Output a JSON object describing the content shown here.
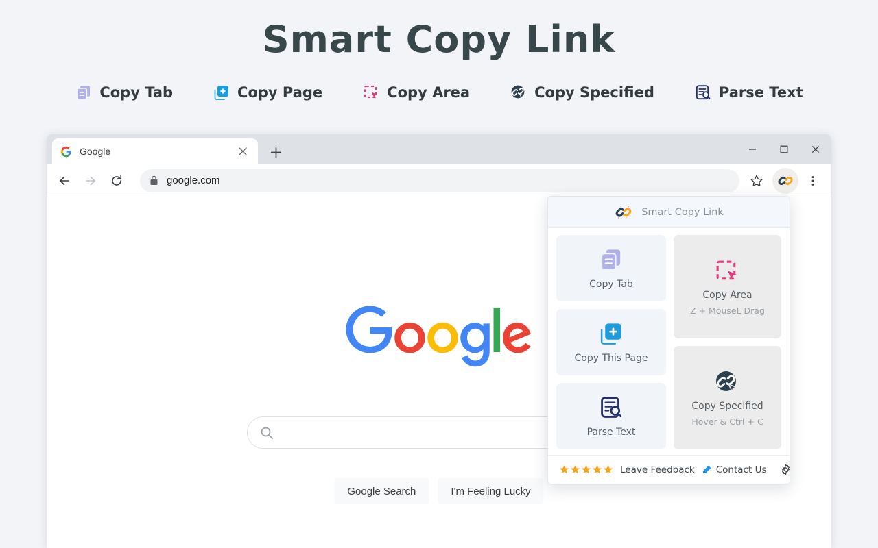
{
  "hero": {
    "title": "Smart Copy Link"
  },
  "features": [
    {
      "label": "Copy Tab",
      "icon": "copy-tab-icon"
    },
    {
      "label": "Copy Page",
      "icon": "copy-page-icon"
    },
    {
      "label": "Copy Area",
      "icon": "copy-area-icon"
    },
    {
      "label": "Copy Specified",
      "icon": "copy-specified-icon"
    },
    {
      "label": "Parse Text",
      "icon": "parse-text-icon"
    }
  ],
  "browser": {
    "tab": {
      "title": "Google",
      "favicon": "google-favicon",
      "close_icon": "close-icon"
    },
    "new_tab_icon": "plus-icon",
    "window_controls": {
      "minimize": "minimize-icon",
      "maximize": "maximize-icon",
      "close": "close-icon"
    },
    "toolbar": {
      "back_icon": "arrow-left-icon",
      "forward_icon": "arrow-right-icon",
      "reload_icon": "reload-icon",
      "lock_icon": "lock-icon",
      "url": "google.com",
      "bookmark_icon": "star-icon",
      "extension_icon": "smart-copy-link-icon",
      "menu_icon": "three-dots-icon"
    }
  },
  "google_page": {
    "logo": "google-logo",
    "search_icon": "search-icon",
    "search_placeholder": "",
    "buttons": [
      "Google Search",
      "I'm Feeling Lucky"
    ]
  },
  "popup": {
    "header": {
      "logo": "smart-copy-link-icon",
      "title": "Smart Copy Link"
    },
    "left_cards": [
      {
        "label": "Copy Tab",
        "icon": "copy-tab-icon"
      },
      {
        "label": "Copy This Page",
        "icon": "copy-page-icon"
      },
      {
        "label": "Parse Text",
        "icon": "parse-text-icon"
      }
    ],
    "right_cards": [
      {
        "label": "Copy Area",
        "hint": "Z + MouseL Drag",
        "icon": "copy-area-icon"
      },
      {
        "label": "Copy Specified",
        "hint": "Hover & Ctrl + C",
        "icon": "copy-specified-icon"
      }
    ],
    "footer": {
      "stars": 5,
      "feedback_label": "Leave Feedback",
      "contact_label": "Contact Us",
      "contact_icon": "pen-icon",
      "settings_icon": "gear-icon"
    }
  },
  "colors": {
    "page_background": "#f2f4f7",
    "title_text": "#37474a",
    "accent_blue": "#1d9bdd",
    "accent_pink": "#e5387f",
    "accent_purple": "#aeb2e8",
    "accent_navy": "#24306b",
    "accent_dark": "#2c4150",
    "star_amber": "#f5a623",
    "card_blue": "#f1f5fa",
    "card_gray": "#ececec"
  }
}
